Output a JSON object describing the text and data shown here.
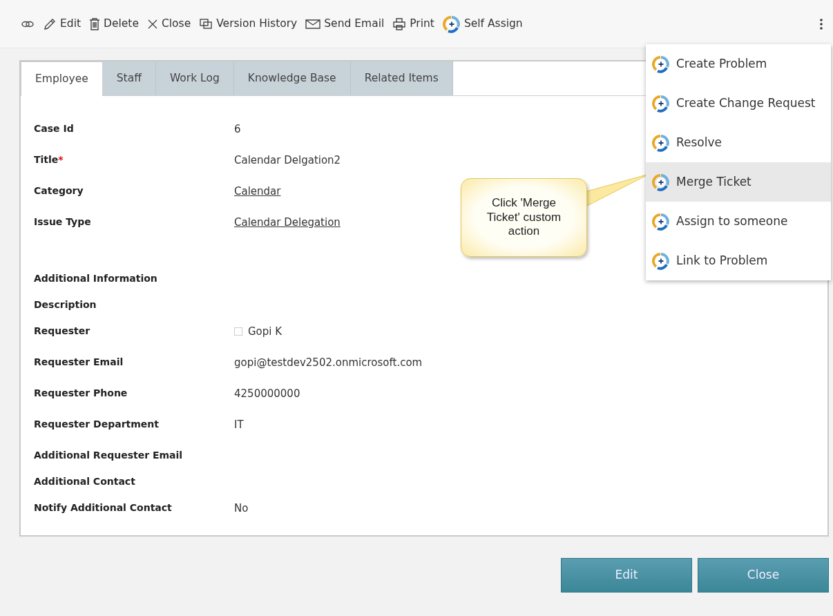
{
  "toolbar": {
    "items": [
      {
        "kind": "link"
      },
      {
        "kind": "edit",
        "label": "Edit"
      },
      {
        "kind": "delete",
        "label": "Delete"
      },
      {
        "kind": "close",
        "label": "Close"
      },
      {
        "kind": "history",
        "label": "Version History"
      },
      {
        "kind": "email",
        "label": "Send Email"
      },
      {
        "kind": "print",
        "label": "Print"
      },
      {
        "kind": "action",
        "label": "Self Assign"
      }
    ]
  },
  "tabs": [
    {
      "label": "Employee",
      "selected": true
    },
    {
      "label": "Staff",
      "selected": false
    },
    {
      "label": "Work Log",
      "selected": false
    },
    {
      "label": "Knowledge Base",
      "selected": false
    },
    {
      "label": "Related Items",
      "selected": false
    }
  ],
  "fields": [
    {
      "kind": "text",
      "label": "Case Id",
      "value": "6"
    },
    {
      "kind": "text",
      "label": "Title",
      "required_mark": "*",
      "value": "Calendar Delgation2"
    },
    {
      "kind": "link",
      "label": "Category",
      "value": "Calendar"
    },
    {
      "kind": "link",
      "label": "Issue Type",
      "value": "Calendar Delegation"
    },
    {
      "kind": "heading",
      "label": "Additional Information"
    },
    {
      "kind": "empty",
      "label": "Description"
    },
    {
      "kind": "person",
      "label": "Requester",
      "value": "Gopi K"
    },
    {
      "kind": "text",
      "label": "Requester Email",
      "value": "gopi@testdev2502.onmicrosoft.com"
    },
    {
      "kind": "text",
      "label": "Requester Phone",
      "value": "4250000000"
    },
    {
      "kind": "text",
      "label": "Requester Department",
      "value": "IT"
    },
    {
      "kind": "empty",
      "label": "Additional Requester Email"
    },
    {
      "kind": "empty",
      "label": "Additional Contact"
    },
    {
      "kind": "text",
      "label": "Notify Additional Contact",
      "value": "No"
    }
  ],
  "actions_menu": {
    "items": [
      {
        "label": "Create Problem",
        "selected": false
      },
      {
        "label": "Create Change Request",
        "selected": false
      },
      {
        "label": "Resolve",
        "selected": false
      },
      {
        "label": "Merge Ticket",
        "selected": true
      },
      {
        "label": "Assign to someone",
        "selected": false
      },
      {
        "label": "Link to Problem",
        "selected": false
      }
    ]
  },
  "callout": {
    "text": "Click 'Merge Ticket' custom action"
  },
  "buttons": [
    "Edit",
    "Close"
  ]
}
